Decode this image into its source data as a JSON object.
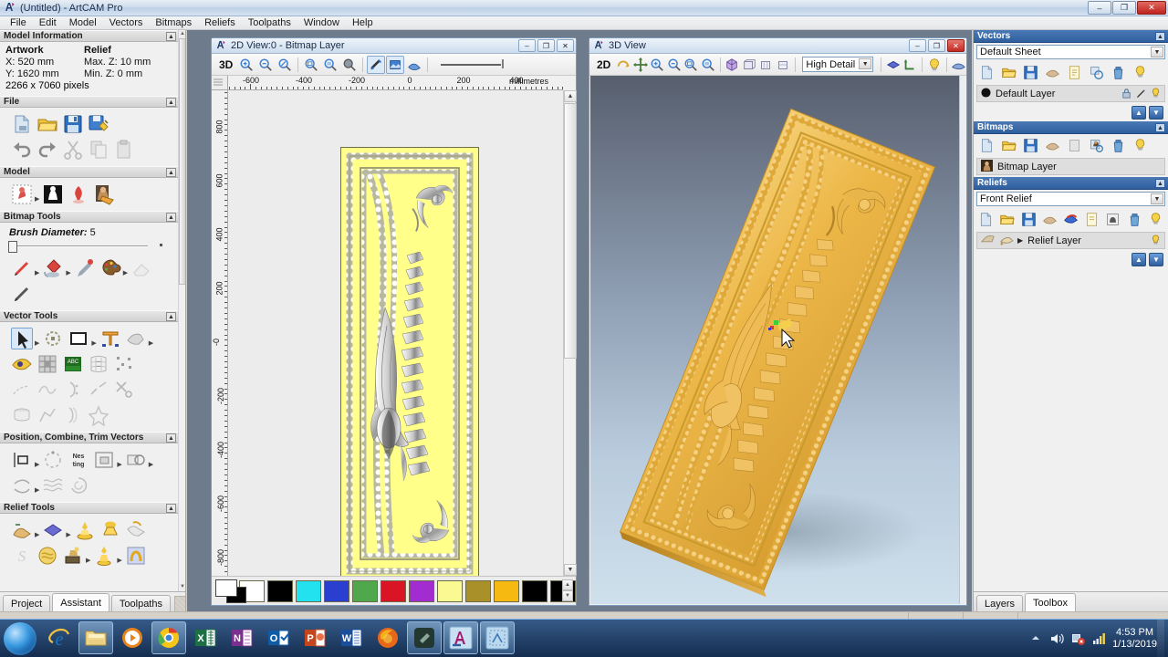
{
  "window": {
    "title": "(Untitled) - ArtCAM Pro",
    "app_icon": "artcam-icon",
    "minimize": "–",
    "maximize": "❐",
    "close": "✕"
  },
  "menubar": {
    "items": [
      "File",
      "Edit",
      "Model",
      "Vectors",
      "Bitmaps",
      "Reliefs",
      "Toolpaths",
      "Window",
      "Help"
    ]
  },
  "left_panel": {
    "sections": [
      {
        "title": "Model Information",
        "artwork_heading": "Artwork",
        "relief_heading": "Relief",
        "artwork_x": "X: 520 mm",
        "artwork_y": "Y: 1620 mm",
        "pixels": "2266 x 7060 pixels",
        "relief_max_z": "Max. Z: 10 mm",
        "relief_min_z": "Min. Z: 0 mm"
      },
      {
        "title": "File"
      },
      {
        "title": "Model"
      },
      {
        "title": "Bitmap Tools",
        "brush_label": "Brush Diameter:",
        "brush_value": "5"
      },
      {
        "title": "Vector Tools"
      },
      {
        "title": "Position, Combine, Trim Vectors"
      },
      {
        "title": "Relief Tools"
      }
    ],
    "tabs": [
      {
        "label": "Project",
        "active": false
      },
      {
        "label": "Assistant",
        "active": true
      },
      {
        "label": "Toolpaths",
        "active": false
      }
    ]
  },
  "view2d": {
    "title": "2D View:0 - Bitmap Layer",
    "toggle_label": "3D",
    "ruler_units": "millimetres",
    "ruler_h_labels": [
      "-600",
      "-400",
      "-200",
      "0",
      "200",
      "400"
    ],
    "ruler_v_labels": [
      "800",
      "600",
      "400",
      "200",
      "-0",
      "-200",
      "-400",
      "-600",
      "-800"
    ],
    "palette": {
      "primary": "#ffffff",
      "secondary": "#000000",
      "swatches": [
        "#ffffff",
        "#000000",
        "#22e2ef",
        "#2a3fd0",
        "#4fa84b",
        "#d81425",
        "#a22ccf",
        "#fbfa92",
        "#a99028",
        "#f5b912",
        "#000000",
        "#000000"
      ]
    },
    "window_buttons": {
      "minimize": "–",
      "maximize": "❐",
      "close": "✕"
    }
  },
  "view3d": {
    "title": "3D View",
    "toggle_label": "2D",
    "detail_level": "High Detail",
    "window_buttons": {
      "minimize": "–",
      "maximize": "❐",
      "close": "✕"
    }
  },
  "right_panel": {
    "vectors": {
      "title": "Vectors",
      "sheet": "Default Sheet",
      "layer": "Default Layer"
    },
    "bitmaps": {
      "title": "Bitmaps",
      "layer": "Bitmap Layer"
    },
    "reliefs": {
      "title": "Reliefs",
      "relief": "Front Relief",
      "layer": "Relief Layer"
    },
    "tabs": [
      {
        "label": "Layers",
        "active": false
      },
      {
        "label": "Toolbox",
        "active": true
      }
    ]
  },
  "taskbar": {
    "start_label": "start-orb",
    "items": [
      {
        "name": "internet-explorer-icon",
        "open": false
      },
      {
        "name": "file-explorer-icon",
        "open": true
      },
      {
        "name": "media-player-icon",
        "open": false
      },
      {
        "name": "google-chrome-icon",
        "open": true
      },
      {
        "name": "excel-icon",
        "open": false
      },
      {
        "name": "onenote-icon",
        "open": false
      },
      {
        "name": "outlook-icon",
        "open": false
      },
      {
        "name": "powerpoint-icon",
        "open": false
      },
      {
        "name": "word-icon",
        "open": false
      },
      {
        "name": "firefox-icon",
        "open": false
      },
      {
        "name": "editor-icon",
        "open": true
      },
      {
        "name": "artcam-icon",
        "open": true
      },
      {
        "name": "artcam-doc-icon",
        "open": true
      }
    ],
    "tray": {
      "show_hidden": "▲",
      "volume": "volume-icon",
      "network": "network-icon",
      "action_center": "action-center-icon",
      "time": "4:53 PM",
      "date": "1/13/2019"
    }
  }
}
